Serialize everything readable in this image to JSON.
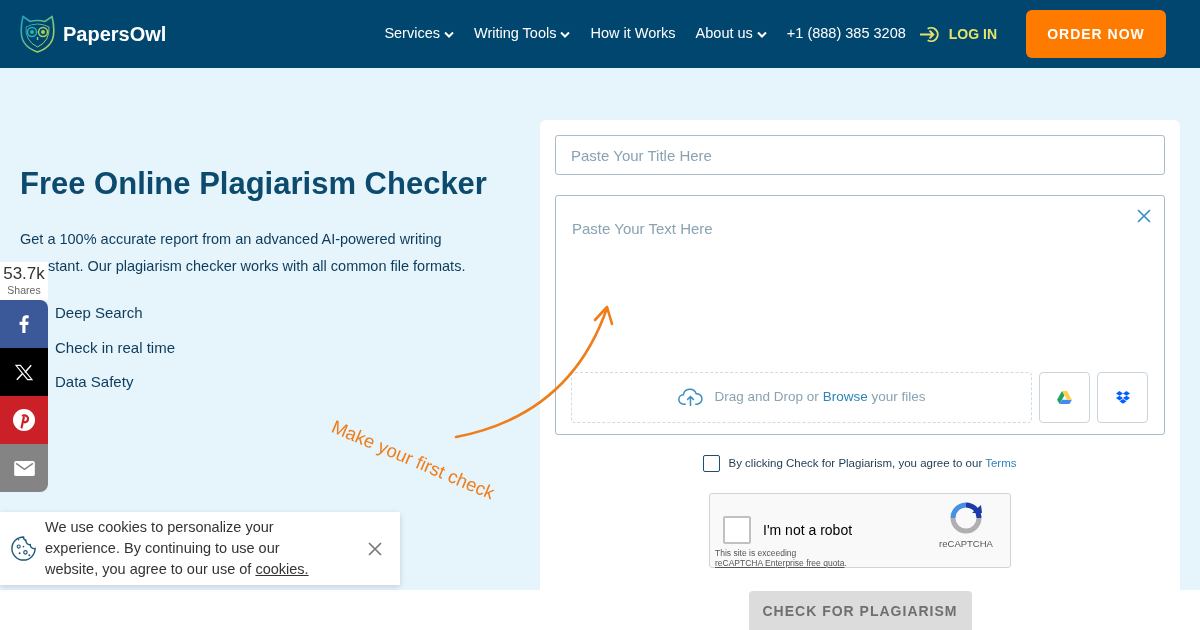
{
  "header": {
    "logo_text": "PapersOwl",
    "nav": [
      {
        "label": "Services",
        "dropdown": true
      },
      {
        "label": "Writing Tools",
        "dropdown": true
      },
      {
        "label": "How it Works",
        "dropdown": false
      },
      {
        "label": "About us",
        "dropdown": true
      }
    ],
    "phone": "+1 (888) 385 3208",
    "login": "LOG IN",
    "order_button": "ORDER NOW"
  },
  "hero": {
    "title": "Free Online Plagiarism Checker",
    "intro_lines": [
      "Get a 100% accurate report from an advanced AI-powered writing",
      "stant. Our plagiarism checker works with all common file formats."
    ],
    "features": [
      "Deep Search",
      "Check in real time",
      "Data Safety"
    ],
    "callout": "Make your first check"
  },
  "share_bar": {
    "count": "53.7k",
    "count_label": "Shares",
    "buttons": [
      {
        "kind": "facebook",
        "color": "#3b5998"
      },
      {
        "kind": "x",
        "color": "#000000"
      },
      {
        "kind": "pinterest",
        "color": "#cb2027"
      },
      {
        "kind": "email",
        "color": "#848484"
      }
    ]
  },
  "checker": {
    "title_field": {
      "placeholder": "Paste Your Title Here"
    },
    "text_field": {
      "placeholder": "Paste Your Text Here"
    },
    "upload": {
      "text": "Drag and Drop or",
      "link": "Browse",
      "text_end": "your files"
    },
    "cloud_buttons": [
      {
        "kind": "google_drive"
      },
      {
        "kind": "dropbox"
      }
    ],
    "agreement": {
      "checked": false,
      "text": "By clicking Check for Plagiarism, you agree to our",
      "link": "Terms"
    },
    "captcha": {
      "checked": false,
      "label": "I'm not a robot",
      "brand": "reCAPTCHA",
      "notice": "This site is exceeding",
      "notice_link": "reCAPTCHA Enterprise free quota",
      "notice_end": "."
    },
    "submit": {
      "label": "CHECK FOR PLAGIARISM",
      "disabled": true
    }
  },
  "cookie_banner": {
    "text": "We use cookies to personalize your experience. By continuing to use our website, you agree to our use of",
    "link": "cookies."
  }
}
